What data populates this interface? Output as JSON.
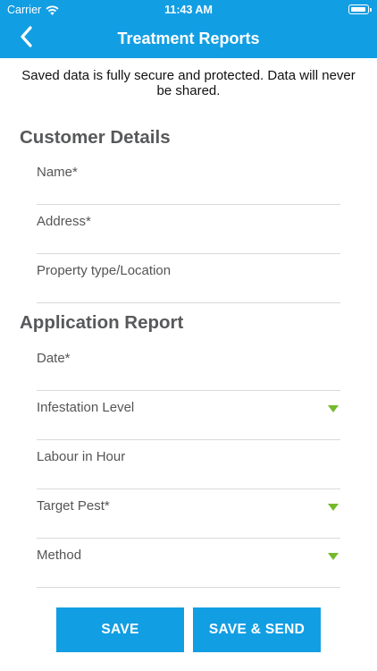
{
  "status_bar": {
    "carrier": "Carrier",
    "time": "11:43 AM",
    "wifi_icon": "wifi-icon",
    "battery_icon": "battery-icon"
  },
  "header": {
    "title": "Treatment Reports",
    "back_icon": "chevron-left-icon",
    "background": "#129ee3"
  },
  "notice": "Saved data is fully secure and protected. Data will never be shared.",
  "customer_details": {
    "title": "Customer Details",
    "fields": [
      {
        "label": "Name*"
      },
      {
        "label": "Address*"
      },
      {
        "label": "Property type/Location"
      }
    ]
  },
  "application_report": {
    "title": "Application Report",
    "fields": [
      {
        "label": "Date*"
      },
      {
        "label": "Infestation Level",
        "dropdown_icon": "triangle-down-icon"
      },
      {
        "label": "Labour in Hour"
      },
      {
        "label": "Target Pest*",
        "dropdown_icon": "triangle-down-icon"
      },
      {
        "label": "Method",
        "dropdown_icon": "triangle-down-icon"
      }
    ]
  },
  "buttons": {
    "save": "SAVE",
    "save_send": "SAVE & SEND"
  },
  "colors": {
    "accent": "#129ee3",
    "dropdown_arrow": "#74b92c",
    "section_title": "#58595b"
  }
}
